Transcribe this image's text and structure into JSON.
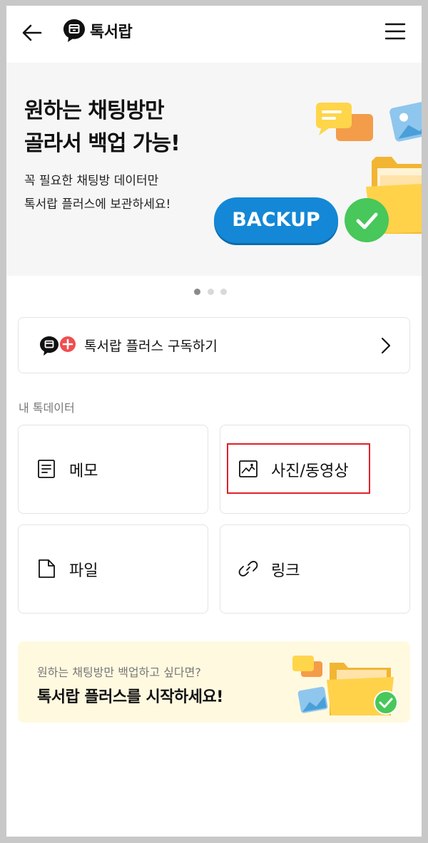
{
  "header": {
    "title": "톡서랍"
  },
  "banner": {
    "title": "원하는 채팅방만\n골라서 백업 가능!",
    "subtitle": "꼭 필요한 채팅방 데이터만\n톡서랍 플러스에 보관하세요!",
    "badge_text": "BACKUP",
    "pagination": {
      "current": 1,
      "total": 3
    }
  },
  "subscribe": {
    "label": "톡서랍 플러스 구독하기"
  },
  "section": {
    "label": "내 톡데이터"
  },
  "grid": {
    "items": [
      {
        "label": "메모",
        "icon": "memo-icon"
      },
      {
        "label": "사진/동영상",
        "icon": "image-icon"
      },
      {
        "label": "파일",
        "icon": "file-icon"
      },
      {
        "label": "링크",
        "icon": "link-icon"
      }
    ]
  },
  "promo": {
    "subtitle": "원하는 채팅방만 백업하고 싶다면?",
    "title": "톡서랍 플러스를 시작하세요!"
  },
  "colors": {
    "accent_blue": "#1488d6",
    "check_green": "#48c75a",
    "plus_red": "#f04e4e",
    "promo_bg": "#fff9e0",
    "highlight_red": "#e0202a"
  }
}
